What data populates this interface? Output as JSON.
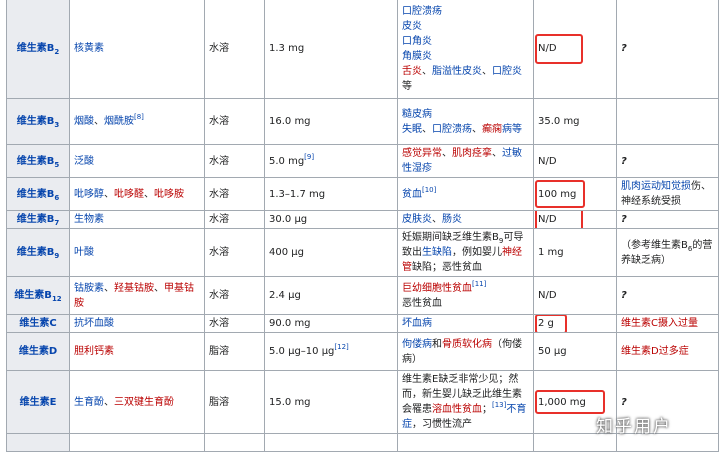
{
  "rows": [
    {
      "vitamin": "维生素B",
      "sub": "2",
      "chem": [
        {
          "t": "核黄素",
          "c": "blue"
        }
      ],
      "solubility": "水溶",
      "intake": "1.3 mg",
      "deficiency": [
        [
          {
            "t": "口腔溃疡",
            "c": "blue"
          }
        ],
        [
          {
            "t": "皮炎",
            "c": "blue"
          }
        ],
        [
          {
            "t": "口角炎",
            "c": "blue"
          }
        ],
        [
          {
            "t": "角膜炎",
            "c": "blue"
          }
        ],
        [
          {
            "t": "舌炎",
            "c": "red"
          },
          {
            "t": "、",
            "c": "black"
          },
          {
            "t": "脂溢性皮炎",
            "c": "blue"
          },
          {
            "t": "、",
            "c": "black"
          },
          {
            "t": "口腔炎",
            "c": "blue"
          }
        ],
        [
          {
            "t": "等",
            "c": "black"
          }
        ]
      ],
      "upper": "N/D",
      "upper_boxed": true,
      "overdose": [
        {
          "t": "?",
          "c": "italic"
        }
      ]
    },
    {
      "vitamin": "维生素B",
      "sub": "3",
      "chem": [
        {
          "t": "烟酸",
          "c": "blue"
        },
        {
          "t": "、",
          "c": "black"
        },
        {
          "t": "烟酰胺",
          "c": "blue"
        },
        {
          "t": "[8]",
          "c": "sup"
        }
      ],
      "solubility": "水溶",
      "intake": "16.0 mg",
      "deficiency": [
        [
          {
            "t": "糙皮病",
            "c": "blue"
          }
        ],
        [
          {
            "t": "失眠",
            "c": "blue"
          },
          {
            "t": "、",
            "c": "black"
          },
          {
            "t": "口腔溃疡",
            "c": "blue"
          },
          {
            "t": "、",
            "c": "black"
          },
          {
            "t": "癫痫",
            "c": "red"
          },
          {
            "t": "病等",
            "c": "blue"
          }
        ]
      ],
      "upper": "35.0 mg",
      "upper_boxed": false,
      "overdose": []
    },
    {
      "vitamin": "维生素B",
      "sub": "5",
      "chem": [
        {
          "t": "泛酸",
          "c": "blue"
        }
      ],
      "solubility": "水溶",
      "intake": "5.0 mg",
      "intake_sup": "[9]",
      "deficiency": [
        [
          {
            "t": "感觉异常",
            "c": "red"
          },
          {
            "t": "、",
            "c": "black"
          },
          {
            "t": "肌肉痉挛",
            "c": "red"
          },
          {
            "t": "、",
            "c": "black"
          },
          {
            "t": "过敏",
            "c": "blue"
          }
        ],
        [
          {
            "t": "性湿疹",
            "c": "blue"
          }
        ]
      ],
      "upper": "N/D",
      "upper_boxed": false,
      "overdose": [
        {
          "t": "?",
          "c": "italic"
        }
      ]
    },
    {
      "vitamin": "维生素B",
      "sub": "6",
      "chem": [
        {
          "t": "吡哆醇",
          "c": "blue"
        },
        {
          "t": "、",
          "c": "black"
        },
        {
          "t": "吡哆醛",
          "c": "red"
        },
        {
          "t": "、",
          "c": "black"
        },
        {
          "t": "吡哆胺",
          "c": "red"
        }
      ],
      "solubility": "水溶",
      "intake": "1.3–1.7 mg",
      "deficiency": [
        [
          {
            "t": "贫血",
            "c": "blue"
          },
          {
            "t": "[10]",
            "c": "sup"
          }
        ]
      ],
      "upper": "100 mg",
      "upper_boxed": true,
      "overdose": [
        {
          "t": "肌肉运动知觉损",
          "c": "blue"
        },
        {
          "t": "伤",
          "c": "black"
        },
        {
          "t": "、",
          "c": "black"
        },
        {
          "t": "神经系统受损",
          "c": "black"
        }
      ]
    },
    {
      "vitamin": "维生素B",
      "sub": "7",
      "chem": [
        {
          "t": "生物素",
          "c": "blue"
        }
      ],
      "solubility": "水溶",
      "intake": "30.0 μg",
      "deficiency": [
        [
          {
            "t": "皮肤炎",
            "c": "blue"
          },
          {
            "t": "、",
            "c": "black"
          },
          {
            "t": "肠炎",
            "c": "blue"
          }
        ]
      ],
      "upper": "N/D",
      "upper_boxed": true,
      "overdose": [
        {
          "t": "?",
          "c": "italic"
        }
      ]
    },
    {
      "vitamin": "维生素B",
      "sub": "9",
      "chem": [
        {
          "t": "叶酸",
          "c": "blue"
        }
      ],
      "solubility": "水溶",
      "intake": "400 μg",
      "deficiency": [
        [
          {
            "t": "妊娠期间缺乏维生素B",
            "c": "black"
          },
          {
            "t": "9",
            "c": "sub"
          },
          {
            "t": "可导",
            "c": "black"
          }
        ],
        [
          {
            "t": "致出",
            "c": "black"
          },
          {
            "t": "生缺陷",
            "c": "blue"
          },
          {
            "t": "，例如婴儿",
            "c": "black"
          },
          {
            "t": "神经",
            "c": "red"
          }
        ],
        [
          {
            "t": "管",
            "c": "red"
          },
          {
            "t": "缺陷；恶性贫血",
            "c": "black"
          }
        ]
      ],
      "upper": "1 mg",
      "upper_boxed": false,
      "overdose": [
        {
          "t": "（参考维生素B",
          "c": "black"
        },
        {
          "t": "6",
          "c": "sub"
        },
        {
          "t": "的",
          "c": "black"
        },
        {
          "t": "营养缺乏病）",
          "c": "black"
        }
      ]
    },
    {
      "vitamin": "维生素B",
      "sub": "12",
      "chem": [
        {
          "t": "钴胺素",
          "c": "blue"
        },
        {
          "t": "、",
          "c": "black"
        },
        {
          "t": "羟基钴胺",
          "c": "red"
        },
        {
          "t": "、",
          "c": "black"
        },
        {
          "t": "甲基钴",
          "c": "red"
        },
        {
          "t": "胺",
          "c": "red"
        }
      ],
      "solubility": "水溶",
      "intake": "2.4 μg",
      "deficiency": [
        [
          {
            "t": "巨幼细胞性贫血",
            "c": "red"
          },
          {
            "t": "[11]",
            "c": "sup"
          }
        ],
        [
          {
            "t": "恶性贫血",
            "c": "black"
          }
        ]
      ],
      "upper": "N/D",
      "upper_boxed": false,
      "overdose": [
        {
          "t": "?",
          "c": "italic"
        }
      ]
    },
    {
      "vitamin": "维生素C",
      "sub": "",
      "chem": [
        {
          "t": "抗坏血酸",
          "c": "blue"
        }
      ],
      "solubility": "水溶",
      "intake": "90.0 mg",
      "deficiency": [
        [
          {
            "t": "坏血病",
            "c": "blue"
          }
        ]
      ],
      "upper": "2 g",
      "upper_boxed": true,
      "overdose": [
        {
          "t": "维生素C摄入过量",
          "c": "red"
        }
      ]
    },
    {
      "vitamin": "维生素D",
      "sub": "",
      "chem": [
        {
          "t": "胆利钙素",
          "c": "red"
        }
      ],
      "solubility": "脂溶",
      "intake": "5.0 μg–10 μg",
      "intake_sup": "[12]",
      "deficiency": [
        [
          {
            "t": "佝偻病",
            "c": "blue"
          },
          {
            "t": "和",
            "c": "black"
          },
          {
            "t": "骨质软化病",
            "c": "red"
          },
          {
            "t": "（佝偻",
            "c": "black"
          }
        ],
        [
          {
            "t": "病）",
            "c": "black"
          }
        ]
      ],
      "upper": "50 μg",
      "upper_boxed": false,
      "overdose": [
        {
          "t": "维生素D过多症",
          "c": "red"
        }
      ]
    },
    {
      "vitamin": "维生素E",
      "sub": "",
      "chem": [
        {
          "t": "生育酚",
          "c": "blue"
        },
        {
          "t": "、",
          "c": "black"
        },
        {
          "t": "三双键生育酚",
          "c": "red"
        }
      ],
      "solubility": "脂溶",
      "intake": "15.0 mg",
      "deficiency": [
        [
          {
            "t": "维生素E缺乏非常少见；然",
            "c": "black"
          }
        ],
        [
          {
            "t": "而，新生婴儿缺乏此维生素",
            "c": "black"
          }
        ],
        [
          {
            "t": "会罹患",
            "c": "black"
          },
          {
            "t": "溶血性贫血",
            "c": "red"
          },
          {
            "t": "；",
            "c": "black"
          },
          {
            "t": "[13]",
            "c": "sup"
          },
          {
            "t": "不育",
            "c": "blue"
          }
        ],
        [
          {
            "t": "症",
            "c": "blue"
          },
          {
            "t": "，习惯性流产",
            "c": "black"
          }
        ]
      ],
      "upper": "1,000 mg",
      "upper_boxed": true,
      "overdose": [
        {
          "t": "?",
          "c": "italic"
        }
      ]
    }
  ],
  "watermark": "知乎用户"
}
